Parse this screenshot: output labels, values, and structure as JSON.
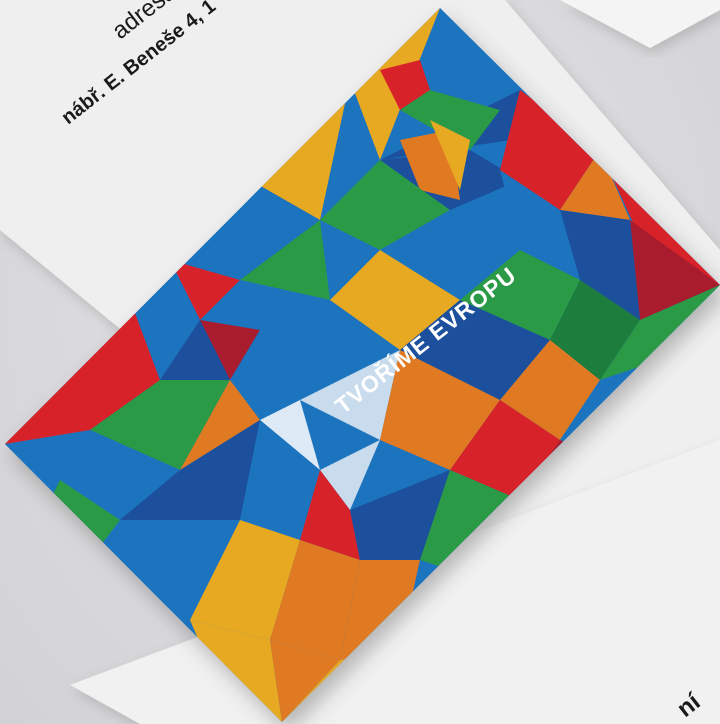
{
  "scene": {
    "type": "business-card-mockup",
    "card_slogan": "TVOŘÍME EVROPU",
    "back_paper_label": "adresa",
    "back_paper_address": "nábř. E. Beneše 4, 1",
    "bottom_paper_fragment": "ní"
  },
  "colors": {
    "blue": "#1e73be",
    "dark_blue": "#1a4f9c",
    "yellow": "#e8a921",
    "orange": "#e07a22",
    "red": "#d8232a",
    "dark_red": "#a81e2d",
    "green": "#2a9a47",
    "dark_green": "#1f7d3c",
    "light": "#c9dced"
  }
}
